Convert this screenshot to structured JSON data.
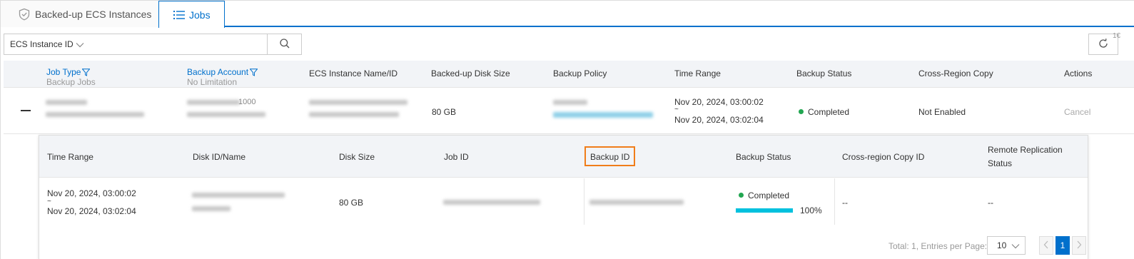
{
  "tabs": [
    {
      "label": "Backed-up ECS Instances",
      "active": false,
      "icon": "shield-icon"
    },
    {
      "label": "Jobs",
      "active": true,
      "icon": "list-icon"
    }
  ],
  "toolbar": {
    "filter_select_value": "ECS Instance ID",
    "search_value": "",
    "corner_label": "1€"
  },
  "main_table": {
    "headers": {
      "job_type": "Job Type",
      "job_type_sub": "Backup Jobs",
      "backup_account": "Backup Account",
      "backup_account_sub": "No Limitation",
      "instance_name": "ECS Instance Name/ID",
      "disk_size": "Backed-up Disk Size",
      "backup_policy": "Backup Policy",
      "time_range": "Time Range",
      "backup_status": "Backup Status",
      "cross_region": "Cross-Region Copy",
      "actions": "Actions"
    },
    "row": {
      "account_partial": "1000",
      "disk_size": "80 GB",
      "time_start": "Nov 20, 2024, 03:00:02",
      "time_sep": "~",
      "time_end": "Nov 20, 2024, 03:02:04",
      "status": "Completed",
      "cross_region": "Not Enabled",
      "action": "Cancel"
    }
  },
  "sub_table": {
    "headers": {
      "time_range": "Time Range",
      "disk": "Disk ID/Name",
      "disk_size": "Disk Size",
      "job_id": "Job ID",
      "backup_id": "Backup ID",
      "backup_status": "Backup Status",
      "cross_region_copy_id": "Cross-region Copy ID",
      "remote_replication_1": "Remote Replication",
      "remote_replication_2": "Status"
    },
    "row": {
      "time_start": "Nov 20, 2024, 03:00:02",
      "time_sep": "~",
      "time_end": "Nov 20, 2024, 03:02:04",
      "disk_size": "80 GB",
      "status": "Completed",
      "progress_percent": 100,
      "progress_label": "100%",
      "cross_region_copy_id": "--",
      "remote_replication": "--"
    },
    "footer": {
      "summary": "Total: 1, Entries per Page:",
      "page_size": "10",
      "current_page": "1"
    }
  },
  "colors": {
    "primary": "#0070cc",
    "success": "#22a651",
    "progress": "#00c1de",
    "highlight": "#f07d1a"
  }
}
